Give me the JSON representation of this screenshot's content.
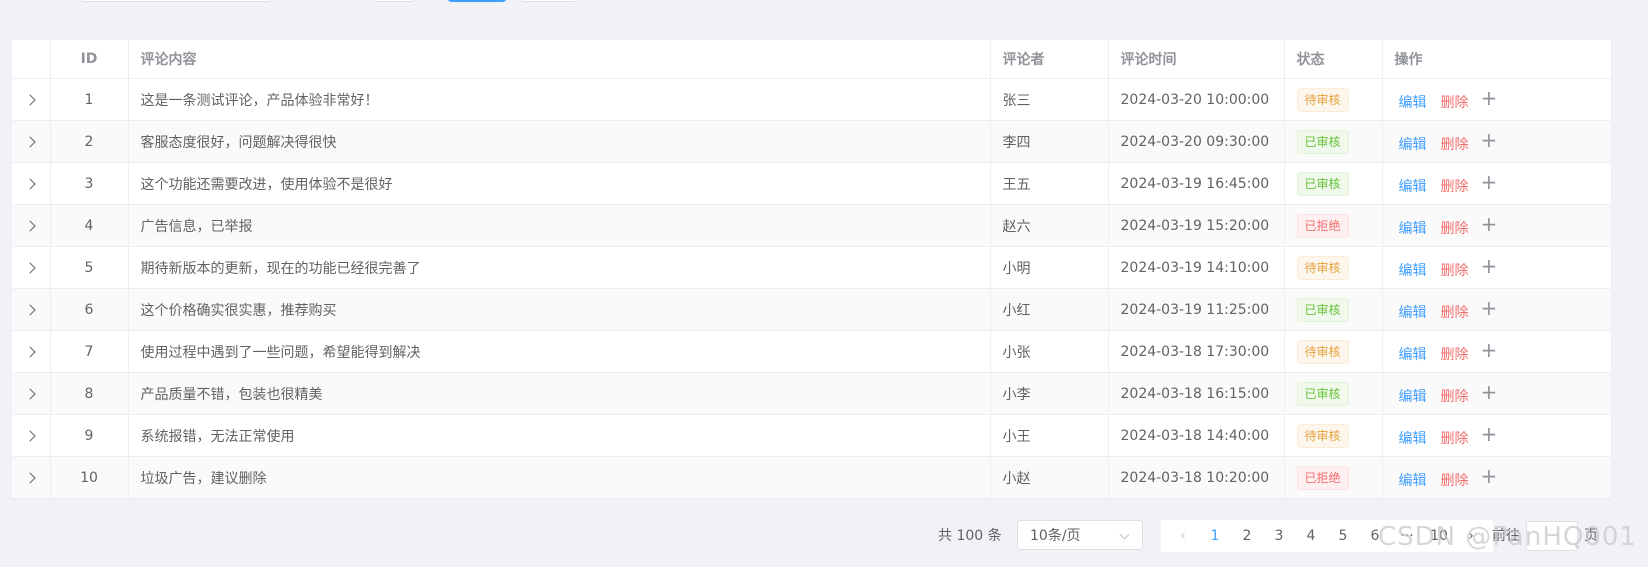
{
  "table": {
    "headers": [
      "",
      "ID",
      "评论内容",
      "评论者",
      "评论时间",
      "状态",
      "操作"
    ],
    "rows": [
      {
        "id": "1",
        "content": "这是一条测试评论，产品体验非常好！",
        "author": "张三",
        "time": "2024-03-20 10:00:00",
        "status": "待审核",
        "status_type": "warn"
      },
      {
        "id": "2",
        "content": "客服态度很好，问题解决得很快",
        "author": "李四",
        "time": "2024-03-20 09:30:00",
        "status": "已审核",
        "status_type": "ok"
      },
      {
        "id": "3",
        "content": "这个功能还需要改进，使用体验不是很好",
        "author": "王五",
        "time": "2024-03-19 16:45:00",
        "status": "已审核",
        "status_type": "ok"
      },
      {
        "id": "4",
        "content": "广告信息，已举报",
        "author": "赵六",
        "time": "2024-03-19 15:20:00",
        "status": "已拒绝",
        "status_type": "danger"
      },
      {
        "id": "5",
        "content": "期待新版本的更新，现在的功能已经很完善了",
        "author": "小明",
        "time": "2024-03-19 14:10:00",
        "status": "待审核",
        "status_type": "warn"
      },
      {
        "id": "6",
        "content": "这个价格确实很实惠，推荐购买",
        "author": "小红",
        "time": "2024-03-19 11:25:00",
        "status": "已审核",
        "status_type": "ok"
      },
      {
        "id": "7",
        "content": "使用过程中遇到了一些问题，希望能得到解决",
        "author": "小张",
        "time": "2024-03-18 17:30:00",
        "status": "待审核",
        "status_type": "warn"
      },
      {
        "id": "8",
        "content": "产品质量不错，包装也很精美",
        "author": "小李",
        "time": "2024-03-18 16:15:00",
        "status": "已审核",
        "status_type": "ok"
      },
      {
        "id": "9",
        "content": "系统报错，无法正常使用",
        "author": "小王",
        "time": "2024-03-18 14:40:00",
        "status": "待审核",
        "status_type": "warn"
      },
      {
        "id": "10",
        "content": "垃圾广告，建议删除",
        "author": "小赵",
        "time": "2024-03-18 10:20:00",
        "status": "已拒绝",
        "status_type": "danger"
      }
    ],
    "actions": {
      "edit": "编辑",
      "delete": "删除",
      "more": "+"
    }
  },
  "pagination": {
    "total_text": "共 100 条",
    "page_size": "10条/页",
    "prev_icon": "chevron-left-icon",
    "pages": [
      "1",
      "2",
      "3",
      "4",
      "5",
      "6",
      "···",
      "10"
    ],
    "current": "1",
    "next_icon": "chevron-right-icon",
    "goto_label": "前往",
    "page_suffix": "页"
  },
  "watermark": "CSDN @PanHQ001",
  "colors": {
    "primary": "#409eff",
    "danger": "#f56c6c",
    "warning": "#e6a23c",
    "success": "#67c23a"
  }
}
